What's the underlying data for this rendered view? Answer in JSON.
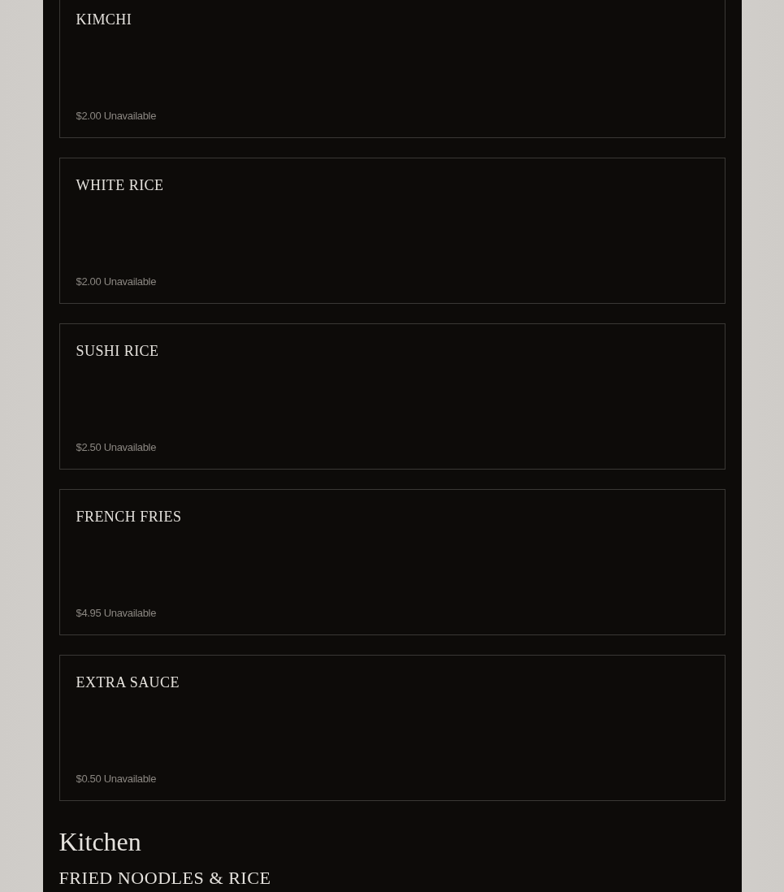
{
  "items": [
    {
      "name": "KIMCHI",
      "price": "$2.00",
      "status": "Unavailable"
    },
    {
      "name": "WHITE RICE",
      "price": "$2.00",
      "status": "Unavailable"
    },
    {
      "name": "SUSHI RICE",
      "price": "$2.50",
      "status": "Unavailable"
    },
    {
      "name": "FRENCH FRIES",
      "price": "$4.95",
      "status": "Unavailable"
    },
    {
      "name": "EXTRA SAUCE",
      "price": "$0.50",
      "status": "Unavailable"
    }
  ],
  "section": {
    "title": "Kitchen",
    "subtitle": "FRIED NOODLES & RICE"
  }
}
